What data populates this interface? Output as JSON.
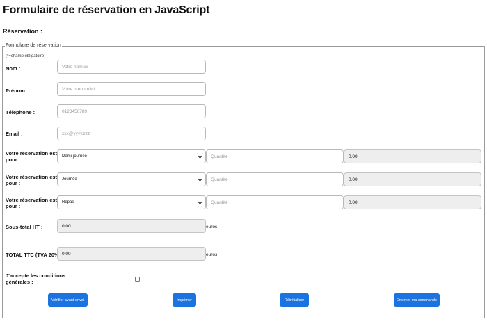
{
  "page": {
    "title": "Formulaire de réservation en JavaScript",
    "section_heading": "Réservation :"
  },
  "form": {
    "legend": "Formulaire de réservation",
    "required_note": "(*=champ obligatoire)",
    "nom": {
      "label": "Nom :",
      "placeholder": "Votre nom ici",
      "value": ""
    },
    "prenom": {
      "label": "Prénom :",
      "placeholder": "Votre prenom ici",
      "value": ""
    },
    "telephone": {
      "label": "Téléphone :",
      "placeholder": "0123456789",
      "value": ""
    },
    "email": {
      "label": "Email :",
      "placeholder": "xxx@yyyy.zzz",
      "value": ""
    },
    "reservations": [
      {
        "label_line1": "Votre réservation est",
        "label_line2": "pour :",
        "selected": "Demi-journée",
        "quantity_placeholder": "Quantité",
        "amount": "0.00"
      },
      {
        "label_line1": "Votre réservation est",
        "label_line2": "pour :",
        "selected": "Journée",
        "quantity_placeholder": "Quantité",
        "amount": "0.00"
      },
      {
        "label_line1": "Votre réservation est",
        "label_line2": "pour :",
        "selected": "Repas",
        "quantity_placeholder": "Quantité",
        "amount": "0.00"
      }
    ],
    "sous_total": {
      "label": "Sous-total HT :",
      "value": "0.00",
      "unit": "euros"
    },
    "total_ttc": {
      "label": "TOTAL TTC (TVA 20%) :",
      "value": "0.00",
      "unit": "euros"
    },
    "conditions": {
      "label_line1": "J'accepte les conditions",
      "label_line2": "générales :",
      "checked": false
    },
    "buttons": {
      "verify": "Vérifier avant envoi",
      "print": "Imprimer",
      "reset": "Réinitialiser",
      "send": "Envoyer ma commande"
    }
  },
  "icons": {
    "select_arrow": "chevron-down-icon"
  },
  "colors": {
    "button_bg": "#1a73e0",
    "button_text": "#ffffff",
    "readonly_bg": "#eeeeee"
  }
}
